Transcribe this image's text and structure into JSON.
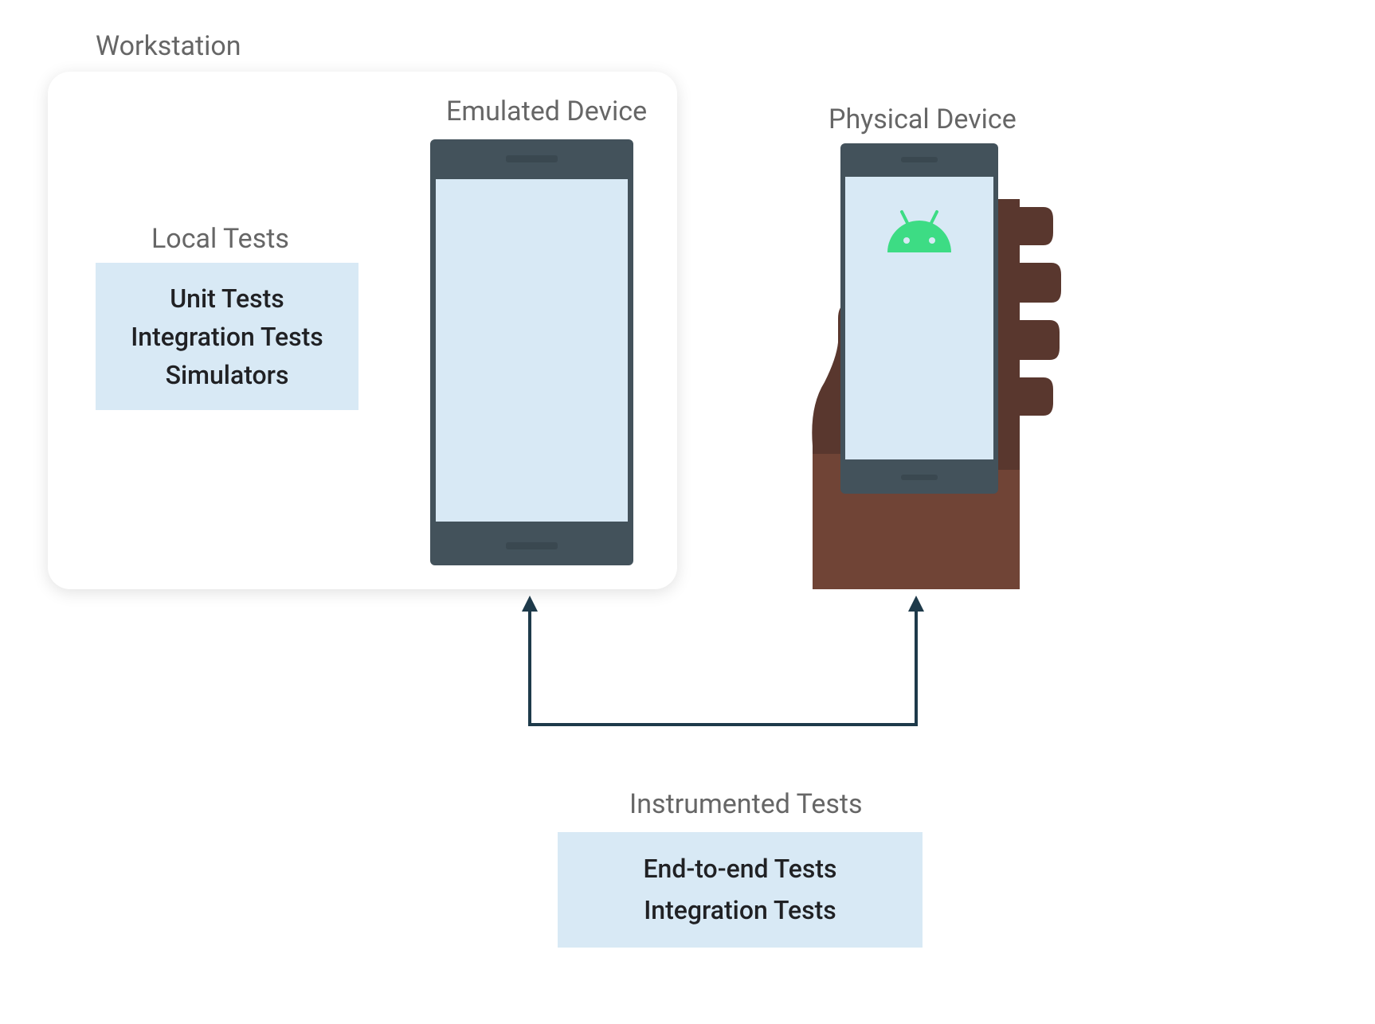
{
  "workstation": {
    "label": "Workstation"
  },
  "localTests": {
    "label": "Local Tests",
    "items": [
      "Unit Tests",
      "Integration Tests",
      "Simulators"
    ]
  },
  "emulated": {
    "label": "Emulated Device"
  },
  "physical": {
    "label": "Physical Device",
    "icon": "android-icon"
  },
  "instrumented": {
    "label": "Instrumented Tests",
    "items": [
      "End-to-end Tests",
      "Integration Tests"
    ]
  },
  "colors": {
    "boxBg": "#d8e9f5",
    "phoneFrame": "#43525b",
    "textMuted": "#666",
    "textDark": "#202124",
    "connector": "#1e3a4a",
    "android": "#3ddc84",
    "handDark": "#59372e",
    "handLight": "#704436"
  }
}
